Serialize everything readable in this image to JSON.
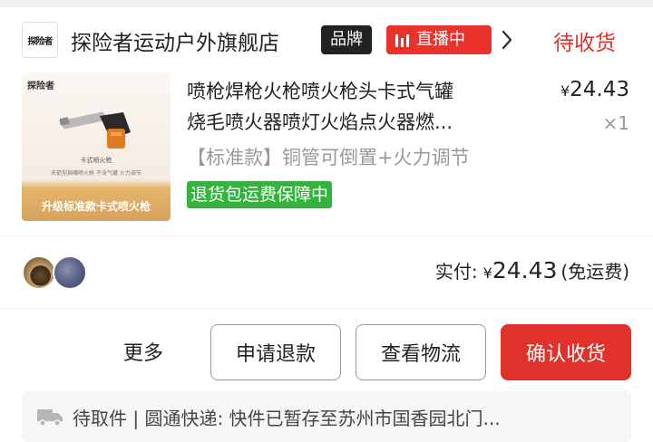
{
  "store": {
    "logo_text": "探险者",
    "name": "探险者运动户外旗舰店",
    "brand_badge": "品牌",
    "live_badge": "直播中",
    "order_status": "待收货"
  },
  "product": {
    "image_logo_text": "探险者",
    "image_caption": "卡式喷火枪",
    "image_subcaption": "天箭型扁嘴喷火枪  不含气罐  火力调节",
    "image_banner": "升级标准款卡式喷火枪",
    "title_line1": "喷枪焊枪火枪喷火枪头卡式气罐",
    "title_line2": "烧毛喷火器喷灯火焰点火器燃...",
    "currency": "¥",
    "price": "24.43",
    "quantity": "×1",
    "variant": "【标准款】铜管可倒置+火力调节",
    "guarantee": "退货包运费保障中"
  },
  "payment": {
    "label": "实付:",
    "currency": "¥",
    "amount": "24.43",
    "shipping_note": "(免运费)"
  },
  "actions": {
    "more": "更多",
    "refund": "申请退款",
    "logistics": "查看物流",
    "confirm": "确认收货"
  },
  "tracking": {
    "text": "待取件 | 圆通快递: 快件已暂存至苏州市国香园北门..."
  },
  "colors": {
    "accent_red": "#e0322a",
    "live_red": "#e8322b",
    "guarantee_green": "#34b33f",
    "brand_black": "#222222"
  },
  "icons": {
    "live": "live-bars-icon",
    "chevron": "chevron-right-icon",
    "truck": "truck-icon"
  }
}
